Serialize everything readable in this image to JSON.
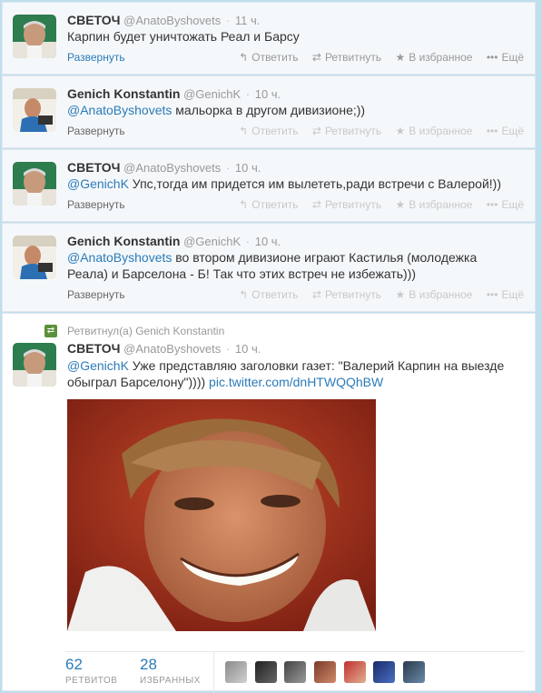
{
  "tweets": [
    {
      "fullname": "СВЕТОЧ",
      "username": "@AnatoByshovets",
      "time": "11 ч.",
      "text": "Карпин будет уничтожать Реал и Барсу",
      "expand": "Развернуть"
    },
    {
      "fullname": "Genich Konstantin",
      "username": "@GenichK",
      "time": "10 ч.",
      "mention": "@AnatoByshovets",
      "text": " мальорка в другом дивизионе;))",
      "expand": "Развернуть"
    },
    {
      "fullname": "СВЕТОЧ",
      "username": "@AnatoByshovets",
      "time": "10 ч.",
      "mention": "@GenichK",
      "text": " Упс,тогда им придется им вылететь,ради встречи с Валерой!))",
      "expand": "Развернуть"
    },
    {
      "fullname": "Genich Konstantin",
      "username": "@GenichK",
      "time": "10 ч.",
      "mention": "@AnatoByshovets",
      "text_line1": " во втором дивизионе играют Кастилья (молодежка",
      "text_line2": "Реала) и Барселона - Б! Так что этих встреч не избежать)))",
      "expand": "Развернуть"
    },
    {
      "retweet_context": "Ретвитнул(а) Genich Konstantin",
      "fullname": "СВЕТОЧ",
      "username": "@AnatoByshovets",
      "time": "10 ч.",
      "mention": "@GenichK",
      "text_line1": " Уже представляю заголовки газет: \"Валерий Карпин на выезде",
      "text_line2": "обыграл Барселону\")))) ",
      "pic_link": "pic.twitter.com/dnHTWQQhBW"
    }
  ],
  "actions": {
    "reply": "Ответить",
    "retweet": "Ретвитнуть",
    "favorite": "В избранное",
    "more": "Ещё"
  },
  "stats": {
    "retweets_count": "62",
    "retweets_label": "РЕТВИТОВ",
    "favorites_count": "28",
    "favorites_label": "ИЗБРАННЫХ"
  },
  "colors": {
    "link": "#2b7bb9",
    "background": "#c0deed",
    "retweet_green": "#5c913b"
  }
}
